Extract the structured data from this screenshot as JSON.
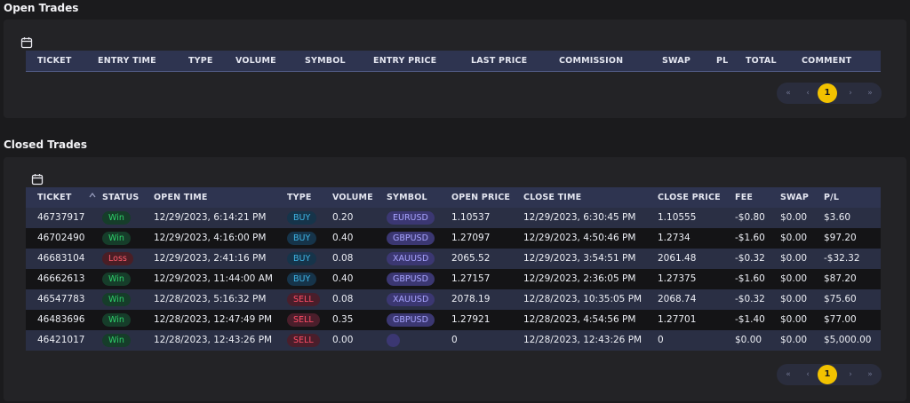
{
  "open_trades": {
    "title": "Open Trades",
    "columns": [
      "TICKET",
      "ENTRY TIME",
      "TYPE",
      "VOLUME",
      "SYMBOL",
      "ENTRY PRICE",
      "LAST PRICE",
      "COMMISSION",
      "SWAP",
      "PL",
      "TOTAL",
      "COMMENT"
    ],
    "pagination": {
      "first": "«",
      "prev": "‹",
      "current": "1",
      "next": "›",
      "last": "»"
    }
  },
  "closed_trades": {
    "title": "Closed Trades",
    "columns": [
      "TICKET",
      "STATUS",
      "OPEN TIME",
      "TYPE",
      "VOLUME",
      "SYMBOL",
      "OPEN PRICE",
      "CLOSE TIME",
      "CLOSE PRICE",
      "FEE",
      "SWAP",
      "P/L"
    ],
    "rows": [
      {
        "ticket": "46737917",
        "status": "Win",
        "open_time": "12/29/2023, 6:14:21 PM",
        "type": "BUY",
        "volume": "0.20",
        "symbol": "EURUSD",
        "open_price": "1.10537",
        "close_time": "12/29/2023, 6:30:45 PM",
        "close_price": "1.10555",
        "fee": "-$0.80",
        "swap": "$0.00",
        "pl": "$3.60"
      },
      {
        "ticket": "46702490",
        "status": "Win",
        "open_time": "12/29/2023, 4:16:00 PM",
        "type": "BUY",
        "volume": "0.40",
        "symbol": "GBPUSD",
        "open_price": "1.27097",
        "close_time": "12/29/2023, 4:50:46 PM",
        "close_price": "1.2734",
        "fee": "-$1.60",
        "swap": "$0.00",
        "pl": "$97.20"
      },
      {
        "ticket": "46683104",
        "status": "Loss",
        "open_time": "12/29/2023, 2:41:16 PM",
        "type": "BUY",
        "volume": "0.08",
        "symbol": "XAUUSD",
        "open_price": "2065.52",
        "close_time": "12/29/2023, 3:54:51 PM",
        "close_price": "2061.48",
        "fee": "-$0.32",
        "swap": "$0.00",
        "pl": "-$32.32"
      },
      {
        "ticket": "46662613",
        "status": "Win",
        "open_time": "12/29/2023, 11:44:00 AM",
        "type": "BUY",
        "volume": "0.40",
        "symbol": "GBPUSD",
        "open_price": "1.27157",
        "close_time": "12/29/2023, 2:36:05 PM",
        "close_price": "1.27375",
        "fee": "-$1.60",
        "swap": "$0.00",
        "pl": "$87.20"
      },
      {
        "ticket": "46547783",
        "status": "Win",
        "open_time": "12/28/2023, 5:16:32 PM",
        "type": "SELL",
        "volume": "0.08",
        "symbol": "XAUUSD",
        "open_price": "2078.19",
        "close_time": "12/28/2023, 10:35:05 PM",
        "close_price": "2068.74",
        "fee": "-$0.32",
        "swap": "$0.00",
        "pl": "$75.60"
      },
      {
        "ticket": "46483696",
        "status": "Win",
        "open_time": "12/28/2023, 12:47:49 PM",
        "type": "SELL",
        "volume": "0.35",
        "symbol": "GBPUSD",
        "open_price": "1.27921",
        "close_time": "12/28/2023, 4:54:56 PM",
        "close_price": "1.27701",
        "fee": "-$1.40",
        "swap": "$0.00",
        "pl": "$77.00"
      },
      {
        "ticket": "46421017",
        "status": "Win",
        "open_time": "12/28/2023, 12:43:26 PM",
        "type": "SELL",
        "volume": "0.00",
        "symbol": "",
        "open_price": "0",
        "close_time": "12/28/2023, 12:43:26 PM",
        "close_price": "0",
        "fee": "$0.00",
        "swap": "$0.00",
        "pl": "$5,000.00"
      }
    ],
    "pagination": {
      "first": "«",
      "prev": "‹",
      "current": "1",
      "next": "›",
      "last": "»"
    }
  },
  "icons": {
    "calendar": "calendar-icon",
    "sort": "sort-icon"
  },
  "colors": {
    "accent": "#f2c200",
    "win": "#2fd06a",
    "loss": "#ff5c6c",
    "buy": "#3fb6e6",
    "sell": "#ff4d66",
    "symbol": "#a8a4ff",
    "header": "#2e3450"
  }
}
